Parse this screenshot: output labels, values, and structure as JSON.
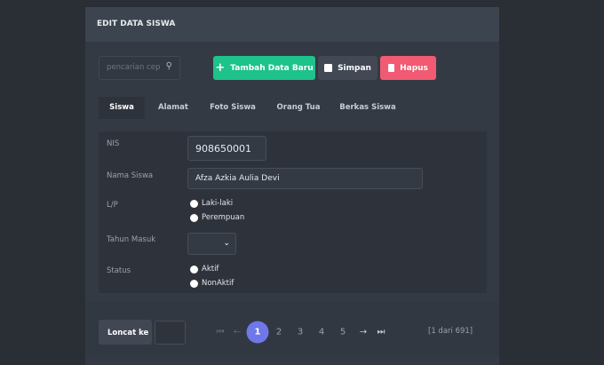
{
  "header": {
    "title": "EDIT DATA SISWA"
  },
  "toolbar": {
    "search_placeholder": "pencarian cep",
    "add_label": "Tambah Data Baru",
    "save_label": "Simpan",
    "delete_label": "Hapus"
  },
  "tabs": [
    "Siswa",
    "Alamat",
    "Foto Siswa",
    "Orang Tua",
    "Berkas Siswa"
  ],
  "form": {
    "nis_label": "NIS",
    "nis_value": "908650001",
    "nama_label": "Nama Siswa",
    "nama_value": "Afza Azkia Aulia Devi",
    "lp_label": "L/P",
    "lp_options": [
      "Laki-laki",
      "Perempuan"
    ],
    "tahun_label": "Tahun Masuk",
    "tahun_value": "",
    "status_label": "Status",
    "status_options": [
      "Aktif",
      "NonAktif"
    ]
  },
  "pagination": {
    "jump_label": "Loncat ke",
    "jump_value": "",
    "pages": [
      "1",
      "2",
      "3",
      "4",
      "5"
    ],
    "current": "1",
    "count_text": "[1 dari 691]"
  },
  "colors": {
    "accent": "#6f78e8",
    "add": "#1ec28b",
    "delete": "#f05a72"
  }
}
